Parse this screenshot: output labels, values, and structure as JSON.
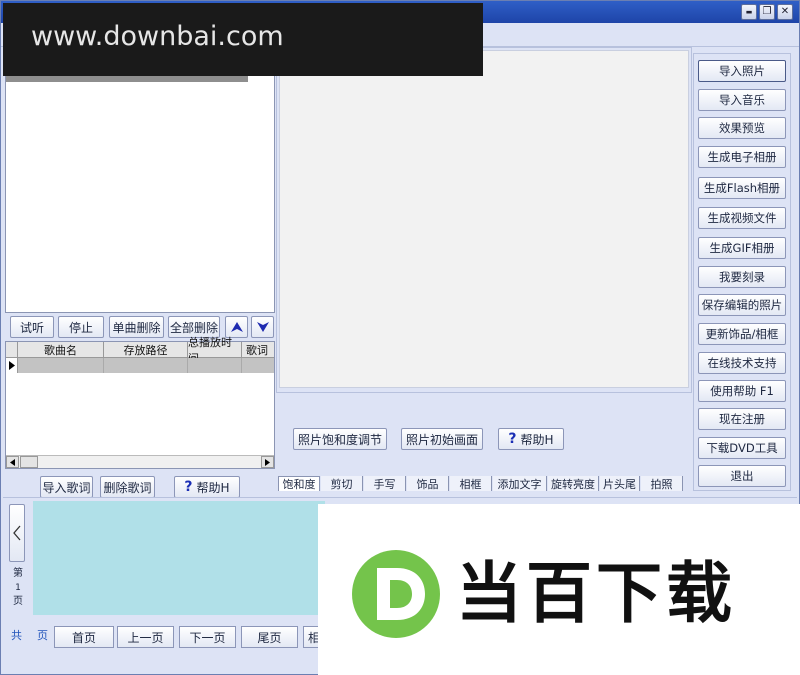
{
  "watermark_url": "www.downbai.com",
  "watermark_brand": "当百下载",
  "watermark_logo_letter": "D",
  "window_controls": {
    "minimize": "▬",
    "restore": "❐",
    "close": "✕"
  },
  "music": {
    "buttons": {
      "audition": "试听",
      "stop": "停止",
      "delete_one": "单曲删除",
      "delete_all": "全部删除"
    },
    "columns": [
      "歌曲名",
      "存放路径",
      "总播放时间",
      "歌词"
    ],
    "lyric_buttons": {
      "import": "导入歌词",
      "delete": "删除歌词",
      "help": "帮助H"
    }
  },
  "editor": {
    "saturation_button": "照片饱和度调节",
    "reset_button": "照片初始画面",
    "help_button": "帮助H",
    "tabs": [
      "饱和度",
      "剪切",
      "手写",
      "饰品",
      "相框",
      "添加文字",
      "旋转亮度",
      "片头尾",
      "拍照"
    ]
  },
  "side_buttons": [
    "导入照片",
    "导入音乐",
    "效果预览",
    "生成电子相册",
    "生成Flash相册",
    "生成视频文件",
    "生成GIF相册",
    "我要刻录",
    "保存编辑的照片",
    "更新饰品/相框",
    "在线技术支持",
    "使用帮助  F1",
    "现在注册",
    "下载DVD工具",
    "退出"
  ],
  "pager": {
    "page_char": "第",
    "page_num": "1",
    "page_suffix": "页",
    "total_char": "共",
    "total_suffix": "页",
    "first": "首页",
    "prev": "上一页",
    "next": "下一页",
    "last": "尾页",
    "more": "相"
  },
  "colors": {
    "window_bg": "#dde3f5",
    "thumb_strip": "#b0e0e8",
    "title_blue": "#2255bb"
  }
}
